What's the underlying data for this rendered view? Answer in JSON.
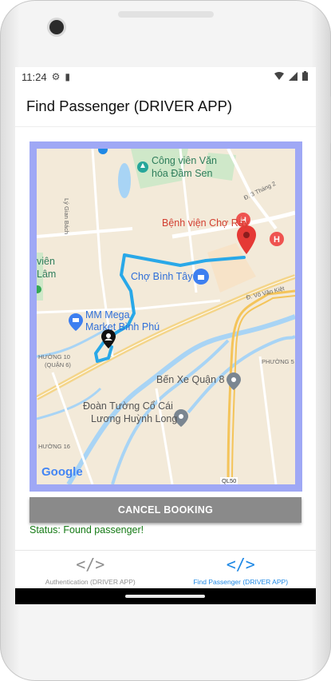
{
  "status_bar": {
    "time": "11:24",
    "icons_left": [
      "gear-icon",
      "sd-card-icon"
    ],
    "icons_right": [
      "wifi-icon",
      "signal-icon",
      "battery-icon"
    ]
  },
  "app_bar": {
    "title": "Find Passenger (DRIVER APP)"
  },
  "map": {
    "labels": {
      "park": "Công viên Văn",
      "park2": "hóa Đầm Sen",
      "hospital": "Bệnh viện Chợ Rẫy",
      "market": "Chợ Bình Tây",
      "mall1": "MM Mega",
      "mall2": "Market Bình Phú",
      "bus": "Bến Xe Quận 8",
      "road1": "Đoàn Tường Cổ Cái",
      "road2": "Lương Huỳnh Long",
      "vien": "viên",
      "lam": "Lâm",
      "ward10": "HƯỜNG 10",
      "q6": "(QUẬN 6)",
      "ward16": "HƯỜNG 16",
      "ward5": "PHƯỜNG 5",
      "vovankiet": "Đ. Võ Văn Kiệt",
      "d3t2": "Đ. 3 Tháng 2",
      "ql50": "QL50",
      "laisan": "Lý Gian Bách",
      "google": "Google"
    }
  },
  "actions": {
    "cancel_label": "CANCEL BOOKING"
  },
  "status": {
    "text": "Status: Found passenger!"
  },
  "bottom_nav": {
    "items": [
      {
        "label": "Authentication (DRIVER APP)",
        "icon": "code-icon",
        "active": false
      },
      {
        "label": "Find Passenger (DRIVER APP)",
        "icon": "code-icon",
        "active": true
      }
    ]
  },
  "colors": {
    "accent": "#1e88e5",
    "route": "#29a8e8",
    "status": "#157a15",
    "frame": "#9fa8f5",
    "button": "#8a8a8a"
  }
}
